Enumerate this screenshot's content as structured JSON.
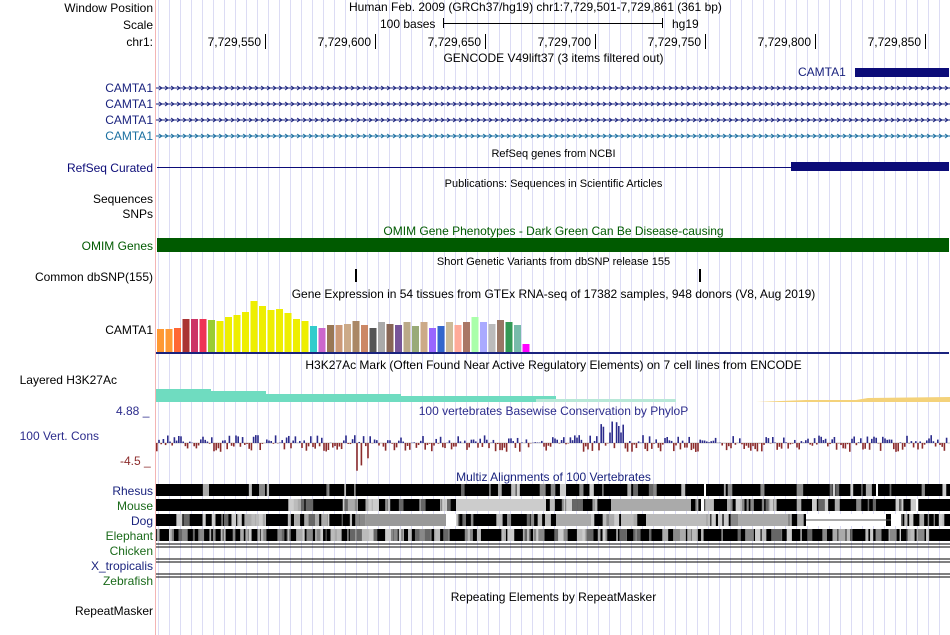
{
  "header": {
    "window_position_label": "Window Position",
    "scale_label": "Scale",
    "chr_label": "chr1:",
    "assembly_text": "Human Feb. 2009 (GRCh37/hg19)   chr1:7,729,501-7,729,861 (361 bp)",
    "scale_bar_text": "100 bases",
    "db": "hg19",
    "ticks": [
      "7,729,550",
      "7,729,600",
      "7,729,650",
      "7,729,700",
      "7,729,750",
      "7,729,800",
      "7,729,850"
    ]
  },
  "gencode": {
    "title": "GENCODE V49lift37 (3 items filtered out)",
    "feature_label": "CAMTA1",
    "transcripts": [
      {
        "label": "CAMTA1",
        "color": "#1a237e"
      },
      {
        "label": "CAMTA1",
        "color": "#1a237e"
      },
      {
        "label": "CAMTA1",
        "color": "#1a237e"
      },
      {
        "label": "CAMTA1",
        "color": "#1a6fa0"
      }
    ]
  },
  "refseq": {
    "label": "RefSeq Curated",
    "title": "RefSeq genes from NCBI",
    "color": "#0c0c78"
  },
  "publications": {
    "label": "Sequences",
    "title": "Publications: Sequences in Scientific Articles"
  },
  "snps_label": "SNPs",
  "omim": {
    "label": "OMIM Genes",
    "title": "OMIM Gene Phenotypes - Dark Green Can Be Disease-causing",
    "color": "#005a00"
  },
  "dbsnp": {
    "label": "Common dbSNP(155)",
    "title": "Short Genetic Variants from dbSNP release 155"
  },
  "gtex": {
    "title": "Gene Expression in 54 tissues from GTEx RNA-seq of 17382 samples, 948 donors (V8, Aug 2019)",
    "label": "CAMTA1",
    "bars": [
      {
        "v": 0.42,
        "c": "#ff9933"
      },
      {
        "v": 0.42,
        "c": "#ff9933"
      },
      {
        "v": 0.45,
        "c": "#ff6633"
      },
      {
        "v": 0.62,
        "c": "#aa3333"
      },
      {
        "v": 0.62,
        "c": "#cc3366"
      },
      {
        "v": 0.62,
        "c": "#ee3355"
      },
      {
        "v": 0.6,
        "c": "#99cc33"
      },
      {
        "v": 0.58,
        "c": "#eeee00"
      },
      {
        "v": 0.65,
        "c": "#eeee00"
      },
      {
        "v": 0.68,
        "c": "#eeee00"
      },
      {
        "v": 0.74,
        "c": "#eeee00"
      },
      {
        "v": 0.95,
        "c": "#eeee00"
      },
      {
        "v": 0.85,
        "c": "#eeee00"
      },
      {
        "v": 0.78,
        "c": "#eeee00"
      },
      {
        "v": 0.8,
        "c": "#eeee00"
      },
      {
        "v": 0.72,
        "c": "#eeee00"
      },
      {
        "v": 0.62,
        "c": "#eeee00"
      },
      {
        "v": 0.58,
        "c": "#eeee00"
      },
      {
        "v": 0.48,
        "c": "#33cccc"
      },
      {
        "v": 0.45,
        "c": "#cc66cc"
      },
      {
        "v": 0.5,
        "c": "#997755"
      },
      {
        "v": 0.5,
        "c": "#cc9977"
      },
      {
        "v": 0.52,
        "c": "#ccaa88"
      },
      {
        "v": 0.58,
        "c": "#aa8866"
      },
      {
        "v": 0.5,
        "c": "#cc8866"
      },
      {
        "v": 0.45,
        "c": "#555555"
      },
      {
        "v": 0.55,
        "c": "#aaaaaa"
      },
      {
        "v": 0.52,
        "c": "#886655"
      },
      {
        "v": 0.5,
        "c": "#775599"
      },
      {
        "v": 0.55,
        "c": "#bbaa88"
      },
      {
        "v": 0.48,
        "c": "#99aa77"
      },
      {
        "v": 0.55,
        "c": "#ccaa88"
      },
      {
        "v": 0.45,
        "c": "#9966ff"
      },
      {
        "v": 0.48,
        "c": "#3366cc"
      },
      {
        "v": 0.55,
        "c": "#ccbb99"
      },
      {
        "v": 0.5,
        "c": "#ffaa99"
      },
      {
        "v": 0.55,
        "c": "#aa7766"
      },
      {
        "v": 0.65,
        "c": "#aaffaa"
      },
      {
        "v": 0.55,
        "c": "#aaaaff"
      },
      {
        "v": 0.52,
        "c": "#bbbbbb"
      },
      {
        "v": 0.6,
        "c": "#997766"
      },
      {
        "v": 0.55,
        "c": "#339955"
      },
      {
        "v": 0.5,
        "c": "#77bbaa"
      },
      {
        "v": 0.15,
        "c": "#ff00ff"
      }
    ]
  },
  "h3k27ac": {
    "label": "Layered H3K27Ac",
    "title": "H3K27Ac Mark (Often Found Near Active Regulatory Elements) on 7 cell lines from ENCODE"
  },
  "cons": {
    "label": "100 Vert. Cons",
    "title": "100 vertebrates Basewise Conservation by PhyloP",
    "max": "4.88 _",
    "min": "-4.5 _",
    "pos_color": "#2c2c8c",
    "neg_color": "#8c2c2c"
  },
  "multiz": {
    "title": "Multiz Alignments of 100 Vertebrates",
    "species": [
      {
        "name": "Rhesus",
        "color": "#1a237e"
      },
      {
        "name": "Mouse",
        "color": "#1a6a1a"
      },
      {
        "name": "Dog",
        "color": "#1a237e"
      },
      {
        "name": "Elephant",
        "color": "#1a6a1a"
      },
      {
        "name": "Chicken",
        "color": "#1a6a1a"
      },
      {
        "name": "X_tropicalis",
        "color": "#1a237e"
      },
      {
        "name": "Zebrafish",
        "color": "#1a6a1a"
      }
    ]
  },
  "repeatmasker": {
    "label": "RepeatMasker",
    "title": "Repeating Elements by RepeatMasker"
  }
}
